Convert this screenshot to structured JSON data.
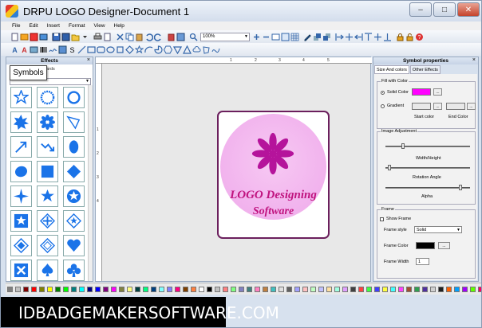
{
  "window": {
    "title": "DRPU LOGO Designer-Document 1"
  },
  "menu": [
    "File",
    "Edit",
    "Insert",
    "Format",
    "View",
    "Help"
  ],
  "toolbar": {
    "zoom": "100%"
  },
  "effects_panel": {
    "title": "Effects",
    "tab_symbols": "Symbols",
    "tab_other": "ards"
  },
  "canvas": {
    "ruler_labels": [
      "1",
      "2",
      "3",
      "4",
      "5"
    ],
    "logo_line1": "LOGO Designing",
    "logo_line2": "Software",
    "colors": {
      "frame": "#6b1f5d",
      "circle": "#f2b5ee",
      "text": "#c0147f",
      "flower": "#b5139b"
    }
  },
  "properties_panel": {
    "title": "Symbol properties",
    "tab_size": "Size And colors",
    "tab_other": "Other Effects",
    "fill_group": "Fill with Color",
    "solid_color": "Solid Color",
    "gradient": "Gradient",
    "start_color": "Start color",
    "end_color": "End Color",
    "solid_swatch": "#ff00ff",
    "adjust_group": "Image Adjustment",
    "width_height": "Width/Height",
    "rotation": "Rotation Angle",
    "alpha": "Alpha",
    "frame_group": "Frame",
    "show_frame": "Show Frame",
    "frame_style_label": "Frame style",
    "frame_style_value": "Solid",
    "frame_color_label": "Frame Color",
    "frame_color_swatch": "#000000",
    "frame_width_label": "Frame Width",
    "frame_width_value": "1",
    "browse": "..."
  },
  "palette": [
    "#808080",
    "#c0c0c0",
    "#800000",
    "#ff0000",
    "#808000",
    "#ffff00",
    "#008000",
    "#00ff00",
    "#008080",
    "#00ffff",
    "#000080",
    "#0000ff",
    "#800080",
    "#ff00ff",
    "#808040",
    "#ffff80",
    "#004040",
    "#00ff80",
    "#004080",
    "#80ffff",
    "#8080ff",
    "#ff0080",
    "#804000",
    "#ff8040",
    "#ffffff",
    "#000000",
    "#c0c0c0",
    "#ff8080",
    "#80ff80",
    "#8080c0",
    "#408080",
    "#ff80c0",
    "#c08040",
    "#40c0c0",
    "#e0e0e0",
    "#606060",
    "#a0a0ff",
    "#ffc0c0",
    "#c0ffc0",
    "#c0c0ff",
    "#ffe0a0",
    "#a0ffe0",
    "#e0a0ff",
    "#404040",
    "#ff4040",
    "#40ff40",
    "#4040ff",
    "#ffff40",
    "#40ffff",
    "#ff40ff",
    "#a05030",
    "#30a050",
    "#5030a0",
    "#d0d0d0",
    "#202020",
    "#ff6000",
    "#00a0ff",
    "#a000ff",
    "#60ff00",
    "#ff0060"
  ],
  "watermark": "IDBADGEMAKERSOFTWARE.COM"
}
